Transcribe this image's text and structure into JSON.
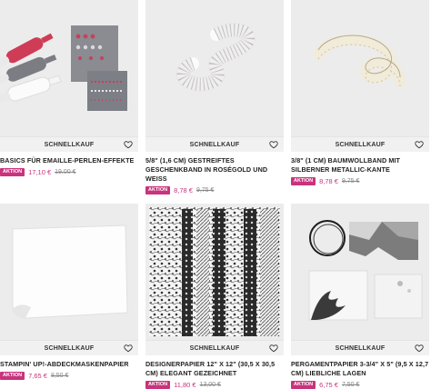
{
  "quick_label": "SCHNELLKAUF",
  "badge_label": "AKTION",
  "products": [
    {
      "title": "BASICS FÜR EMAILLE-PERLEN-EFFEKTE",
      "price": "17,10 €",
      "old_price": "19,00 €"
    },
    {
      "title": "5/8\" (1,6 CM) GESTREIFTES GESCHENKBAND IN ROSÉGOLD UND WEISS",
      "price": "8,78 €",
      "old_price": "9,75 €"
    },
    {
      "title": "3/8\" (1 CM) BAUMWOLLBAND MIT SILBERNER METALLIC-KANTE",
      "price": "8,78 €",
      "old_price": "9,75 €"
    },
    {
      "title": "STAMPIN' UP!-ABDECKMASKENPAPIER",
      "price": "7,65 €",
      "old_price": "8,50 €"
    },
    {
      "title": "DESIGNERPAPIER 12\" X 12\" (30,5 X 30,5 CM) ELEGANT GEZEICHNET",
      "price": "11,80 €",
      "old_price": "13,00 €"
    },
    {
      "title": "PERGAMENTPAPIER 3-3/4\" X 5\" (9,5 X 12,7 CM) LIEBLICHE LAGEN",
      "price": "6,75 €",
      "old_price": "7,50 €"
    }
  ]
}
